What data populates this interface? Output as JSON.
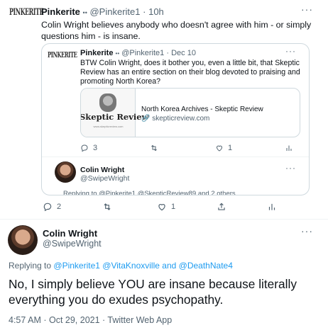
{
  "tweet1": {
    "display_name": "Pinkerite",
    "verified_marks": "••",
    "handle": "@Pinkerite1",
    "separator": "·",
    "time": "10h",
    "text": "Colin Wright believes anybody who doesn't agree with him - or simply questions him - is insane.",
    "avatar_text": "PINKERITE",
    "more": "···",
    "stats": {
      "replies": "2",
      "retweets": "",
      "likes": "1"
    }
  },
  "quoted": {
    "display_name": "Pinkerite",
    "verified_marks": "••",
    "handle": "@Pinkerite1",
    "separator": "·",
    "time": "Dec 10",
    "avatar_text": "PINKERITE",
    "text": "BTW Colin Wright, does it bother you, even a little bit, that Skeptic Review has an entire section on their blog devoted to praising and promoting North Korea?",
    "card": {
      "thumb_text": "Skeptic Review",
      "thumb_url": "www.skepticreview.com",
      "title": "North Korea Archives - Skeptic Review",
      "domain": "skepticreview.com"
    },
    "stats": {
      "replies": "3",
      "retweets": "",
      "likes": "1"
    },
    "reply": {
      "display_name": "Colin Wright",
      "handle": "@SwipeWright",
      "replying": "Replying to @Pinkerite1 @SkepticReview89 and 2 others"
    },
    "more": "···"
  },
  "main": {
    "display_name": "Colin Wright",
    "handle": "@SwipeWright",
    "more": "···",
    "replying_prefix": "Replying to",
    "replying_names": "@Pinkerite1 @VitaKnoxville",
    "replying_and": "and",
    "replying_last": "@DeathNate4",
    "text": "No, I simply believe YOU are insane because literally everything you do exudes psychopathy.",
    "timestamp": "4:57 AM · Oct 29, 2021 · Twitter Web App"
  }
}
